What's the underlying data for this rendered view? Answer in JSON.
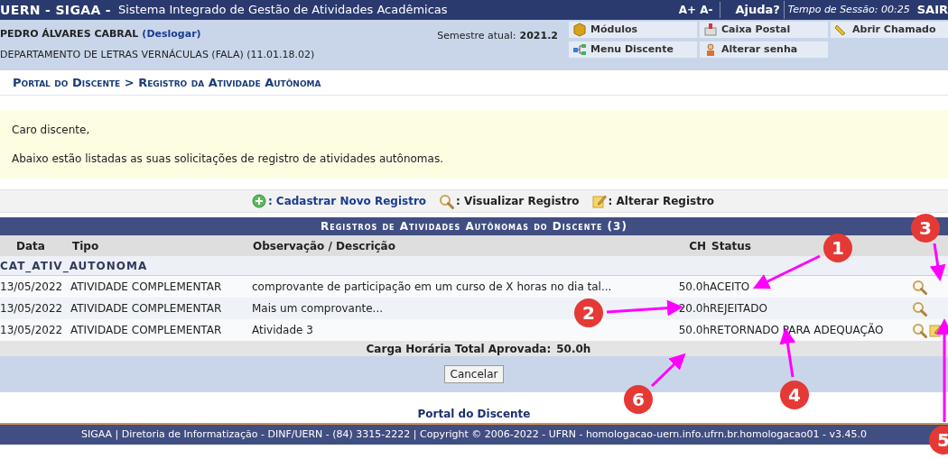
{
  "header": {
    "system": "UERN - SIGAA -",
    "subtitle": "Sistema Integrado de Gestão de Atividades Acadêmicas",
    "font_up": "A+",
    "font_down": "A-",
    "help": "Ajuda?",
    "session": "Tempo de Sessão: 00:25",
    "logout": "SAIR"
  },
  "user": {
    "name": "PEDRO ÁLVARES CABRAL",
    "logout_link": "(Deslogar)",
    "department": "DEPARTAMENTO DE LETRAS VERNÁCULAS (FALA) (11.01.18.02)",
    "semester_label": "Semestre atual:",
    "semester": "2021.2"
  },
  "shortcuts": [
    {
      "kind": "modules",
      "label": "Módulos"
    },
    {
      "kind": "mail",
      "label": "Caixa Postal"
    },
    {
      "kind": "ticket",
      "label": "Abrir Chamado"
    },
    {
      "kind": "menu",
      "label": "Menu Discente"
    },
    {
      "kind": "password",
      "label": "Alterar senha"
    }
  ],
  "breadcrumb": "Portal do Discente > Registro da Atividade Autônoma",
  "notice": [
    "Caro discente,",
    "Abaixo estão listadas as suas solicitações de registro de atividades autônomas."
  ],
  "legend": [
    {
      "kind": "add",
      "label": ": Cadastrar Novo Registro"
    },
    {
      "kind": "view",
      "label": ": Visualizar Registro"
    },
    {
      "kind": "edit",
      "label": ": Alterar Registro"
    }
  ],
  "table": {
    "title": "Registros de Atividades Autônomas do Discente (3)",
    "columns": [
      "Data",
      "Tipo",
      "Observação / Descrição",
      "CH",
      "Status"
    ],
    "group": "CAT_ATIV_AUTONOMA",
    "rows": [
      {
        "date": "13/05/2022",
        "type": "ATIVIDADE COMPLEMENTAR",
        "description": "comprovante de participação em um curso de X horas no dia tal...",
        "ch": "50.0h",
        "status": "ACEITO",
        "viewable": true,
        "editable": false
      },
      {
        "date": "13/05/2022",
        "type": "ATIVIDADE COMPLEMENTAR",
        "description": "Mais um comprovante...",
        "ch": "20.0h",
        "status": "REJEITADO",
        "viewable": true,
        "editable": false
      },
      {
        "date": "13/05/2022",
        "type": "ATIVIDADE COMPLEMENTAR",
        "description": "Atividade 3",
        "ch": "50.0h",
        "status": "RETORNADO PARA ADEQUAÇÃO",
        "viewable": true,
        "editable": true
      }
    ],
    "total_label": "Carga Horária Total Aprovada:",
    "total": "50.0h"
  },
  "cancel_button": "Cancelar",
  "footer_link": "Portal do Discente",
  "footer": "SIGAA | Diretoria de Informatização - DINF/UERN - (84) 3315-2222 | Copyright © 2006-2022 - UFRN - homologacao-uern.info.ufrn.br.homologacao01 - v3.45.0",
  "annotations": [
    "1",
    "2",
    "3",
    "4",
    "5",
    "6"
  ]
}
